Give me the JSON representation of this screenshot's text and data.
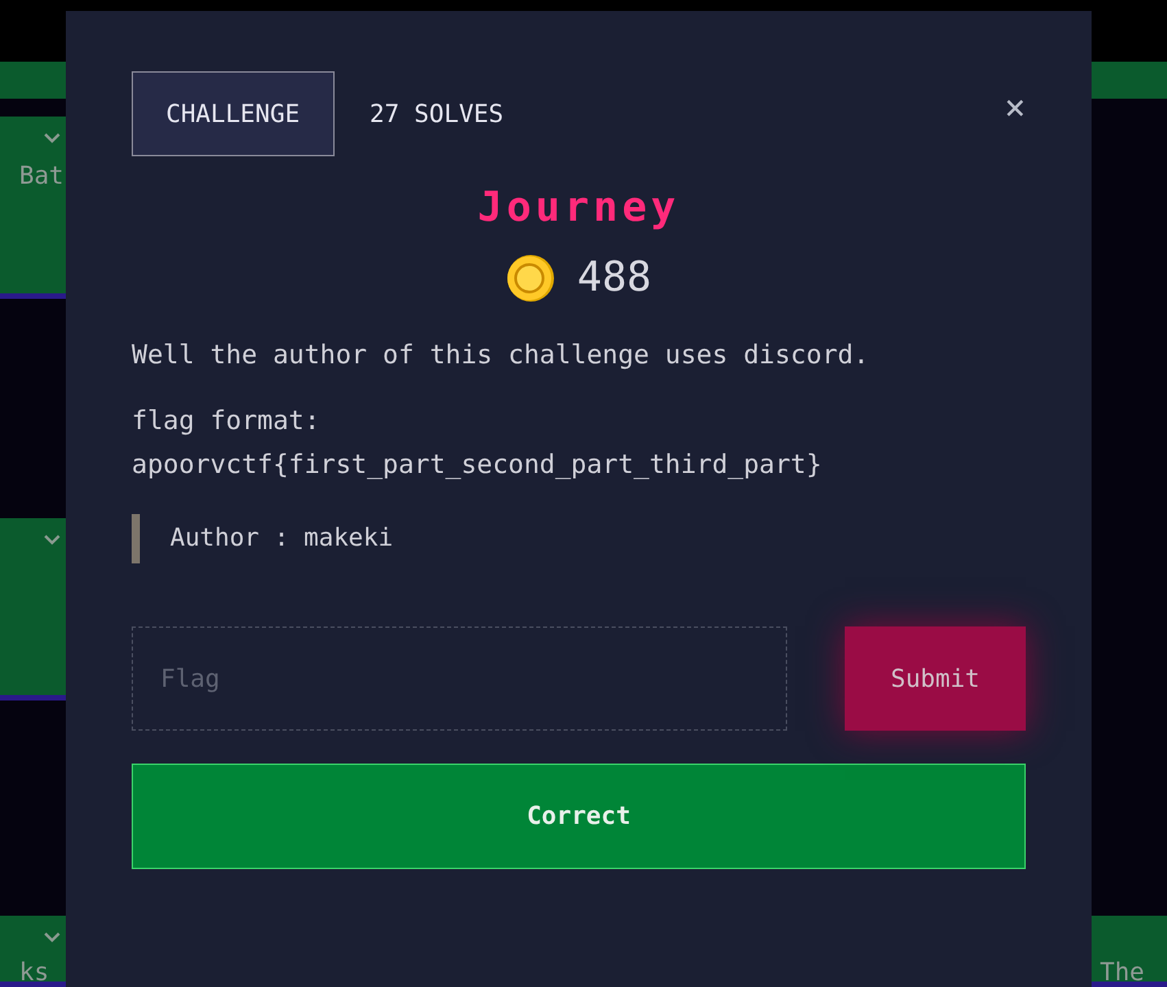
{
  "background": {
    "left_tiles": [
      {
        "label": "Bat"
      },
      {
        "label": "ks"
      }
    ],
    "right_tiles": [
      {
        "label": "The"
      }
    ]
  },
  "modal": {
    "tabs": [
      {
        "label": "CHALLENGE",
        "selected": true
      },
      {
        "label": "27 SOLVES",
        "selected": false
      }
    ],
    "close": "×",
    "title": "Journey",
    "points": "488",
    "description": [
      "Well the author of this challenge uses discord.",
      "flag format:\napoorvctf{first_part_second_part_third_part}"
    ],
    "quote": "Author : makeki",
    "flag_input": {
      "placeholder": "Flag"
    },
    "submit": "Submit",
    "result": {
      "correct": true,
      "label": "Correct"
    }
  }
}
